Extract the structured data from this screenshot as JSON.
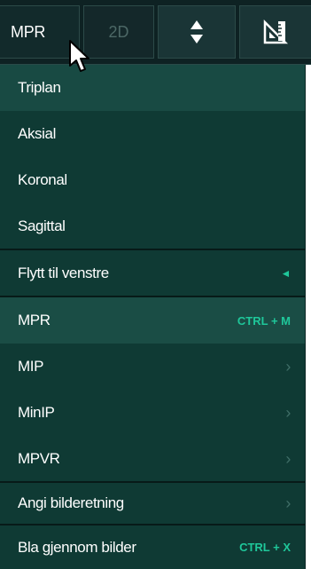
{
  "toolbar": {
    "mpr_label": "MPR",
    "twod_label": "2D",
    "arrows_icon": "sort-up-down-icon",
    "tool_icon": "ruler-set-square-icon"
  },
  "menu": {
    "items": [
      {
        "label": "Triplan"
      },
      {
        "label": "Aksial"
      },
      {
        "label": "Koronal"
      },
      {
        "label": "Sagittal"
      },
      {
        "label": "Flytt til venstre",
        "indicator": "◄"
      },
      {
        "label": "MPR",
        "shortcut": "CTRL + M"
      },
      {
        "label": "MIP",
        "indicator": "›"
      },
      {
        "label": "MinIP",
        "indicator": "›"
      },
      {
        "label": "MPVR",
        "indicator": "›"
      },
      {
        "label": "Angi bilderetning",
        "indicator": "›"
      },
      {
        "label": "Bla gjennom bilder",
        "shortcut": "CTRL + X"
      }
    ]
  },
  "colors": {
    "menu_bg": "#0f3a34",
    "highlight_bg": "#184a43",
    "accent": "#1fc79a",
    "toolbar_bg": "#0e2223"
  }
}
